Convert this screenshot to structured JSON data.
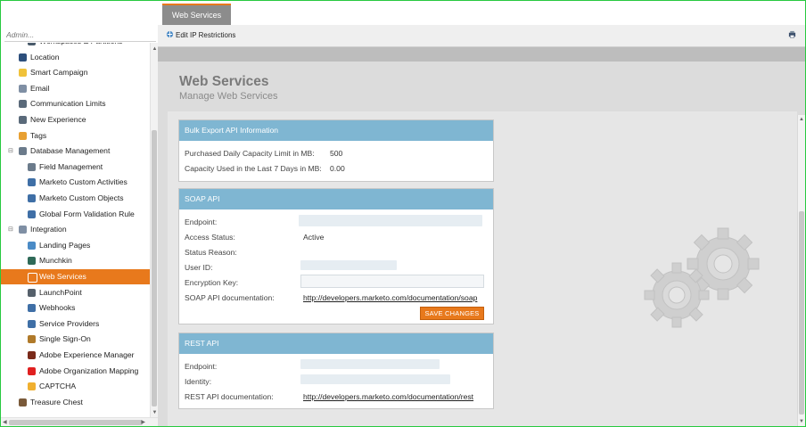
{
  "admin_search": {
    "placeholder": "Admin..."
  },
  "tree": {
    "items": [
      {
        "label": "Workspaces & Partitions",
        "icon": "globe-icon",
        "color": "#4a5b6b"
      },
      {
        "label": "Location",
        "icon": "location-icon",
        "color": "#2d4f7c"
      },
      {
        "label": "Smart Campaign",
        "icon": "lightbulb-icon",
        "color": "#f0c23a"
      },
      {
        "label": "Email",
        "icon": "email-icon",
        "color": "#7f8fa4"
      },
      {
        "label": "Communication Limits",
        "icon": "limit-icon",
        "color": "#5a6a7a"
      },
      {
        "label": "New Experience",
        "icon": "experience-icon",
        "color": "#5a6a7a"
      },
      {
        "label": "Tags",
        "icon": "tag-icon",
        "color": "#e8a032"
      },
      {
        "label": "Database Management",
        "icon": "database-icon",
        "color": "#6b7b8b"
      },
      {
        "label": "Field Management",
        "icon": "field-icon",
        "color": "#6b7b8b"
      },
      {
        "label": "Marketo Custom Activities",
        "icon": "activity-icon",
        "color": "#3f6fa6"
      },
      {
        "label": "Marketo Custom Objects",
        "icon": "object-icon",
        "color": "#3f6fa6"
      },
      {
        "label": "Global Form Validation Rule",
        "icon": "form-icon",
        "color": "#3f6fa6"
      },
      {
        "label": "Integration",
        "icon": "cloud-icon",
        "color": "#7f8fa4"
      },
      {
        "label": "Landing Pages",
        "icon": "landing-page-icon",
        "color": "#4b8bc6"
      },
      {
        "label": "Munchkin",
        "icon": "munchkin-icon",
        "color": "#2f6a58"
      },
      {
        "label": "Web Services",
        "icon": "web-services-icon",
        "color": "#ffffff"
      },
      {
        "label": "LaunchPoint",
        "icon": "rocket-icon",
        "color": "#55606b"
      },
      {
        "label": "Webhooks",
        "icon": "webhook-icon",
        "color": "#3f6fa6"
      },
      {
        "label": "Service Providers",
        "icon": "service-provider-icon",
        "color": "#3f6fa6"
      },
      {
        "label": "Single Sign-On",
        "icon": "key-icon",
        "color": "#b07a2a"
      },
      {
        "label": "Adobe Experience Manager",
        "icon": "aem-icon",
        "color": "#7a2a1a"
      },
      {
        "label": "Adobe Organization Mapping",
        "icon": "adobe-icon",
        "color": "#e02020"
      },
      {
        "label": "CAPTCHA",
        "icon": "captcha-icon",
        "color": "#f0b030"
      },
      {
        "label": "Treasure Chest",
        "icon": "chest-icon",
        "color": "#7a5a3a"
      }
    ],
    "active": "Web Services"
  },
  "tabs": [
    {
      "label": "Web Services",
      "active": true
    }
  ],
  "toolbar": {
    "edit_ip_label": "Edit IP Restrictions"
  },
  "page": {
    "title": "Web Services",
    "subtitle": "Manage Web Services"
  },
  "bulk_export": {
    "header": "Bulk Export API Information",
    "rows": [
      {
        "label": "Purchased Daily Capacity Limit in MB:",
        "value": "500"
      },
      {
        "label": "Capacity Used in the Last 7 Days in MB:",
        "value": "0.00"
      }
    ]
  },
  "soap": {
    "header": "SOAP API",
    "endpoint_label": "Endpoint:",
    "access_status_label": "Access Status:",
    "access_status_value": "Active",
    "status_reason_label": "Status Reason:",
    "user_id_label": "User ID:",
    "encryption_key_label": "Encryption Key:",
    "doc_label": "SOAP API documentation:",
    "doc_link": "http://developers.marketo.com/documentation/soap",
    "save_label": "SAVE CHANGES"
  },
  "rest": {
    "header": "REST API",
    "endpoint_label": "Endpoint:",
    "identity_label": "Identity:",
    "doc_label": "REST API documentation:",
    "doc_link": "http://developers.marketo.com/documentation/rest"
  },
  "colors": {
    "accent": "#e8791c",
    "card_header": "#7fb6d2"
  }
}
